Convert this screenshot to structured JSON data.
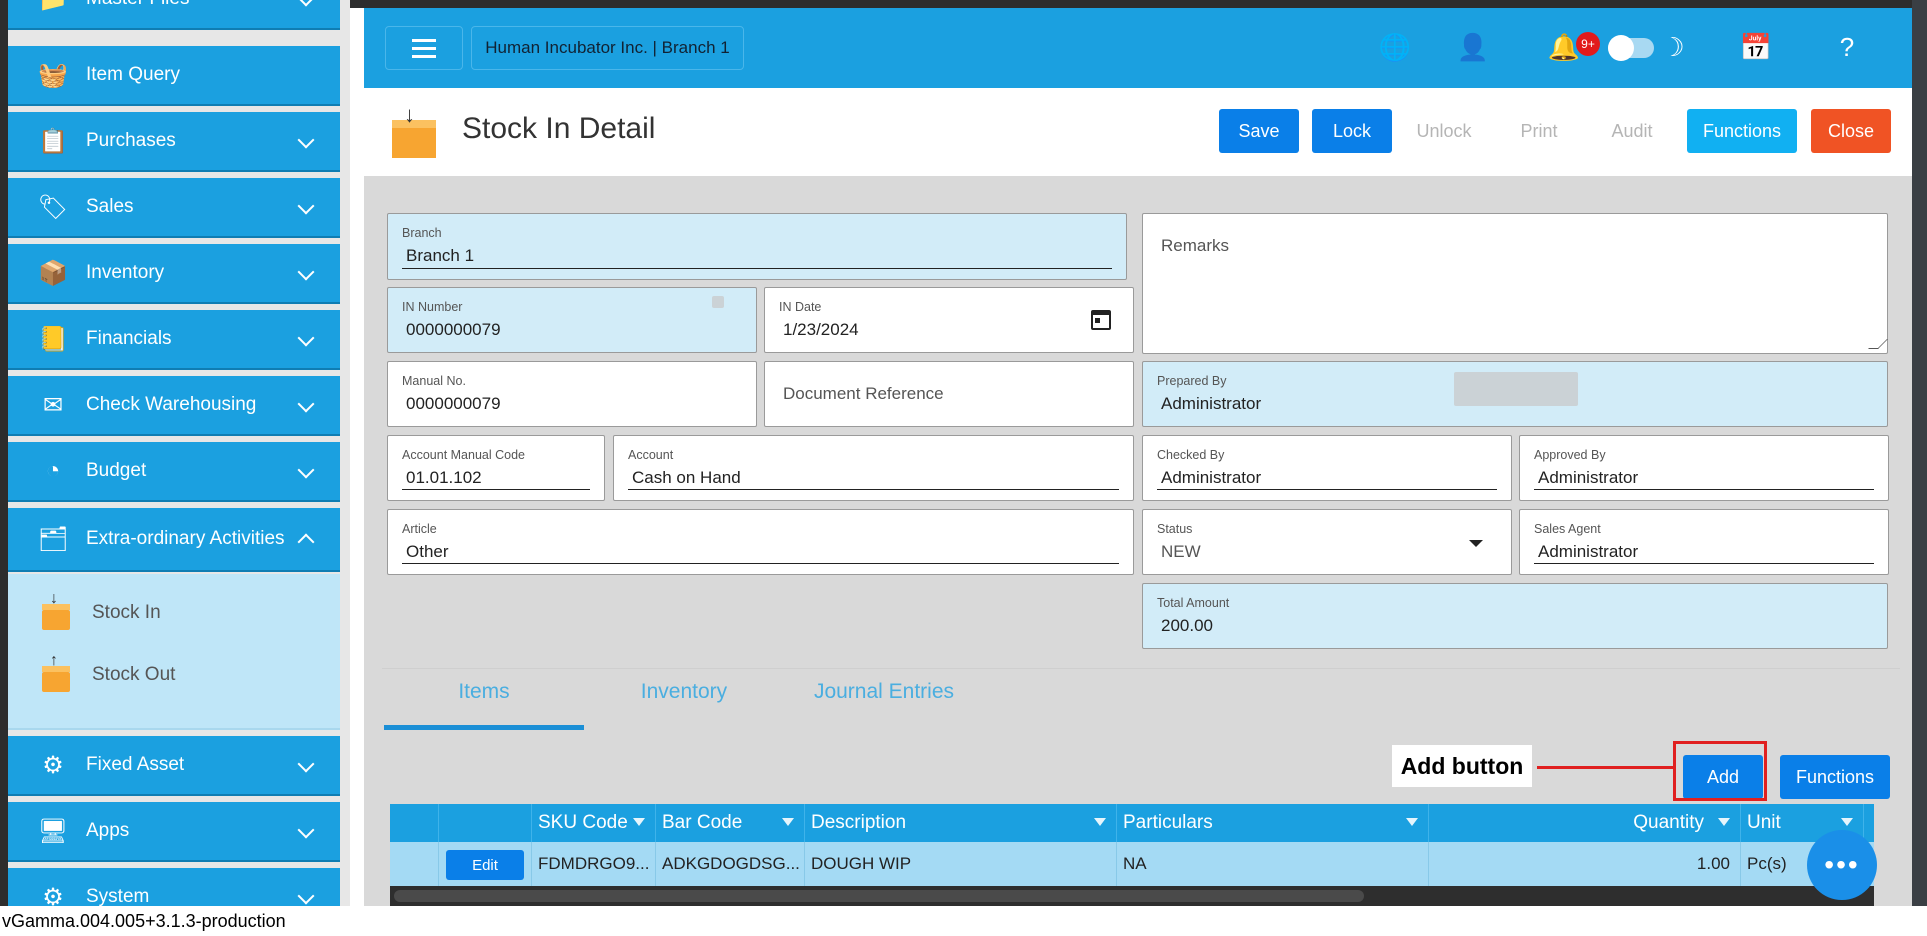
{
  "sidebar": {
    "items": [
      {
        "label": "Master Files",
        "icon": "folder-icon"
      },
      {
        "label": "Item Query",
        "icon": "basket-icon"
      },
      {
        "label": "Purchases",
        "icon": "clipboard-icon"
      },
      {
        "label": "Sales",
        "icon": "sale-tag-icon"
      },
      {
        "label": "Inventory",
        "icon": "boxes-icon"
      },
      {
        "label": "Financials",
        "icon": "ledger-icon"
      },
      {
        "label": "Check Warehousing",
        "icon": "check-icon"
      },
      {
        "label": "Budget",
        "icon": "pie-icon"
      },
      {
        "label": "Extra-ordinary Activities",
        "icon": "activity-icon"
      },
      {
        "label": "Fixed Asset",
        "icon": "asset-icon"
      },
      {
        "label": "Apps",
        "icon": "apps-icon"
      },
      {
        "label": "System",
        "icon": "gear-icon"
      }
    ],
    "subitems": [
      {
        "label": "Stock In",
        "icon": "stock-in-icon"
      },
      {
        "label": "Stock Out",
        "icon": "stock-out-icon"
      }
    ]
  },
  "topbar": {
    "company": "Human Incubator Inc. | Branch 1",
    "notification_badge": "9+"
  },
  "page": {
    "title": "Stock In Detail",
    "buttons": {
      "save": "Save",
      "lock": "Lock",
      "unlock": "Unlock",
      "print": "Print",
      "audit": "Audit",
      "functions": "Functions",
      "close": "Close"
    }
  },
  "form": {
    "branch": {
      "label": "Branch",
      "value": "Branch 1"
    },
    "in_number": {
      "label": "IN Number",
      "value": "0000000079"
    },
    "in_date": {
      "label": "IN Date",
      "value": "1/23/2024"
    },
    "remarks": {
      "label": "Remarks"
    },
    "manual_no": {
      "label": "Manual No.",
      "value": "0000000079"
    },
    "document_reference": {
      "label": "Document Reference"
    },
    "prepared_by": {
      "label": "Prepared By",
      "value": "Administrator"
    },
    "account_manual_code": {
      "label": "Account Manual Code",
      "value": "01.01.102"
    },
    "account": {
      "label": "Account",
      "value": "Cash on Hand"
    },
    "checked_by": {
      "label": "Checked By",
      "value": "Administrator"
    },
    "approved_by": {
      "label": "Approved By",
      "value": "Administrator"
    },
    "article": {
      "label": "Article",
      "value": "Other"
    },
    "status": {
      "label": "Status",
      "value": "NEW"
    },
    "sales_agent": {
      "label": "Sales Agent",
      "value": "Administrator"
    },
    "total_amount": {
      "label": "Total Amount",
      "value": "200.00"
    }
  },
  "tabs": [
    "Items",
    "Inventory",
    "Journal Entries"
  ],
  "annotation": {
    "label": "Add button"
  },
  "grid_toolbar": {
    "add": "Add",
    "functions": "Functions"
  },
  "grid": {
    "columns": [
      "SKU Code",
      "Bar Code",
      "Description",
      "Particulars",
      "Quantity",
      "Unit"
    ],
    "rows": [
      {
        "edit": "Edit",
        "sku": "FDMDRGO9...",
        "barcode": "ADKGDOGDSG...",
        "description": "DOUGH WIP",
        "particulars": "NA",
        "quantity": "1.00",
        "unit": "Pc(s)"
      }
    ]
  },
  "footer": {
    "version": "vGamma.004.005+3.1.3-production"
  },
  "colors": {
    "primary": "#1ba0e0",
    "button": "#0a7fe8",
    "close": "#f05324",
    "annotation": "#e02020"
  }
}
